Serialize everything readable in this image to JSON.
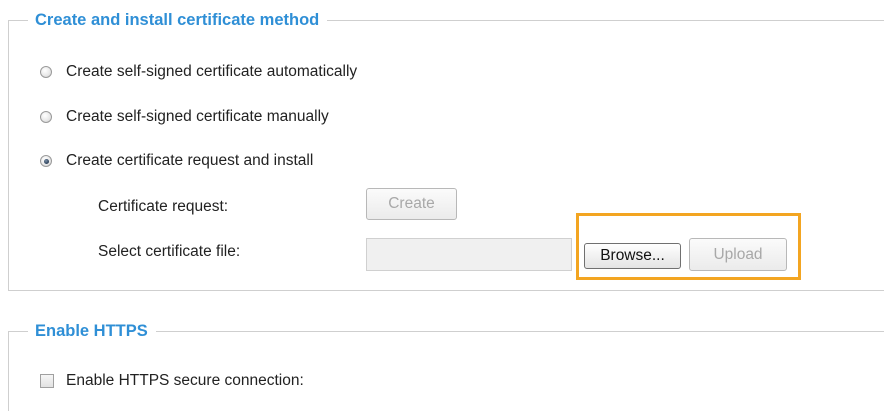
{
  "method_group": {
    "title": "Create and install certificate method",
    "options": [
      {
        "label": "Create self-signed certificate automatically",
        "checked": false
      },
      {
        "label": "Create self-signed certificate manually",
        "checked": false
      },
      {
        "label": "Create certificate request and install",
        "checked": true
      }
    ],
    "certificate_request_label": "Certificate request:",
    "create_button": "Create",
    "select_file_label": "Select certificate file:",
    "file_value": "",
    "browse_button": "Browse...",
    "upload_button": "Upload"
  },
  "https_group": {
    "title": "Enable HTTPS",
    "enable_label": "Enable HTTPS secure connection:",
    "enable_checked": false
  },
  "colors": {
    "legend_blue": "#2f8fd6",
    "highlight_orange": "#f3a521"
  }
}
